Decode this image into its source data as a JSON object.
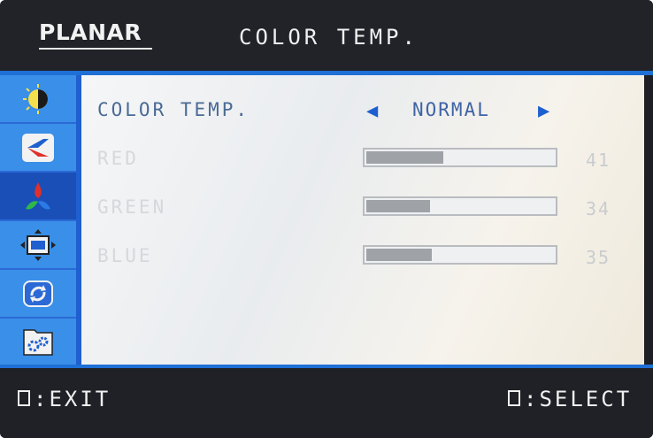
{
  "header": {
    "logo": "PLANAR",
    "title": "COLOR TEMP."
  },
  "sidebar": {
    "items": [
      {
        "icon": "brightness-contrast-icon"
      },
      {
        "icon": "input-source-icon"
      },
      {
        "icon": "color-icon",
        "active": true
      },
      {
        "icon": "image-position-icon"
      },
      {
        "icon": "reset-icon"
      },
      {
        "icon": "setup-gear-icon"
      }
    ]
  },
  "content": {
    "color_temp": {
      "label": "COLOR TEMP.",
      "value": "NORMAL"
    },
    "red": {
      "label": "RED",
      "value": "41",
      "level": 0.41
    },
    "green": {
      "label": "GREEN",
      "value": "34",
      "level": 0.34
    },
    "blue": {
      "label": "BLUE",
      "value": "35",
      "level": 0.35
    }
  },
  "footer": {
    "exit_label": ":EXIT",
    "select_label": ":SELECT"
  },
  "colors": {
    "accent": "#1e6fd6",
    "sidebar_tile": "#3a8fe8",
    "value_text": "#3e64a5"
  }
}
